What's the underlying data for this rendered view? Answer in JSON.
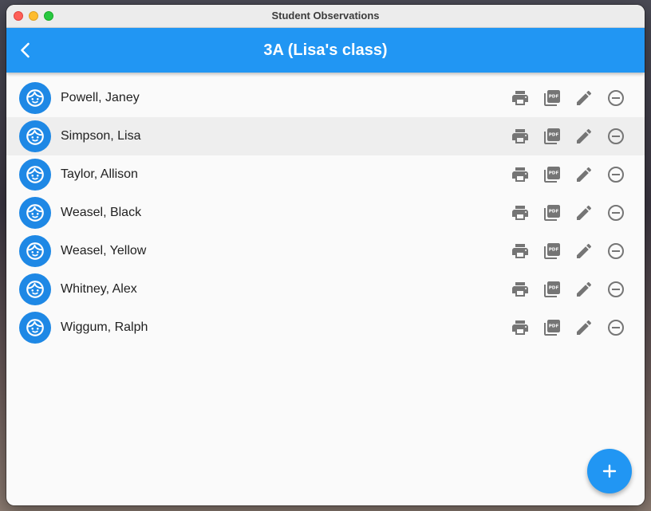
{
  "window": {
    "title": "Student Observations"
  },
  "appbar": {
    "title": "3A (Lisa's class)",
    "back_icon": "chevron-left-icon"
  },
  "students": [
    {
      "name": "Powell, Janey",
      "selected": false
    },
    {
      "name": "Simpson, Lisa",
      "selected": true
    },
    {
      "name": "Taylor, Allison",
      "selected": false
    },
    {
      "name": "Weasel, Black",
      "selected": false
    },
    {
      "name": "Weasel, Yellow",
      "selected": false
    },
    {
      "name": "Whitney, Alex",
      "selected": false
    },
    {
      "name": "Wiggum, Ralph",
      "selected": false
    }
  ],
  "row_actions": [
    "print-icon",
    "pdf-icon",
    "edit-icon",
    "remove-icon"
  ],
  "fab": {
    "icon": "add-icon"
  },
  "colors": {
    "primary": "#2196f3",
    "avatar": "#1e88e5",
    "icon_gray": "#757575",
    "selected_row": "#eeeeee"
  }
}
